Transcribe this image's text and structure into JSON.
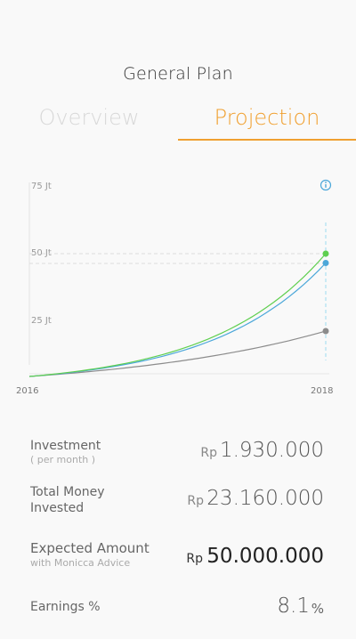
{
  "header": {
    "title": "General Plan"
  },
  "tabs": [
    {
      "label": "Overview",
      "active": false
    },
    {
      "label": "Projection",
      "active": true
    }
  ],
  "colors": {
    "accent": "#f0a030",
    "green": "#5fcf4f",
    "blue": "#4ba7d9",
    "gray": "#8c8c8c"
  },
  "chart_data": {
    "type": "line",
    "x": [
      2016,
      2018
    ],
    "xtick_labels": [
      "2016",
      "2018"
    ],
    "ytick_labels": [
      "75 Jt",
      "50 Jt",
      "25 Jt"
    ],
    "ylim": [
      0,
      75
    ],
    "series": [
      {
        "color": "green",
        "values": [
          4,
          50
        ]
      },
      {
        "color": "blue",
        "values": [
          4,
          46.5
        ]
      },
      {
        "color": "gray",
        "values": [
          4,
          21
        ]
      }
    ],
    "info_icon": "info-icon"
  },
  "stats": {
    "investment": {
      "label": "Investment",
      "sublabel": "( per month )",
      "currency": "Rp",
      "value": "1.930.000"
    },
    "total": {
      "label_line1": "Total Money",
      "label_line2": "Invested",
      "currency": "Rp",
      "value": "23.160.000"
    },
    "expected": {
      "label": "Expected Amount",
      "sublabel": "with Monicca Advice",
      "currency": "Rp",
      "value": "50.000.000"
    },
    "earnings": {
      "label": "Earnings %",
      "value": "8.1",
      "unit": "%"
    }
  }
}
